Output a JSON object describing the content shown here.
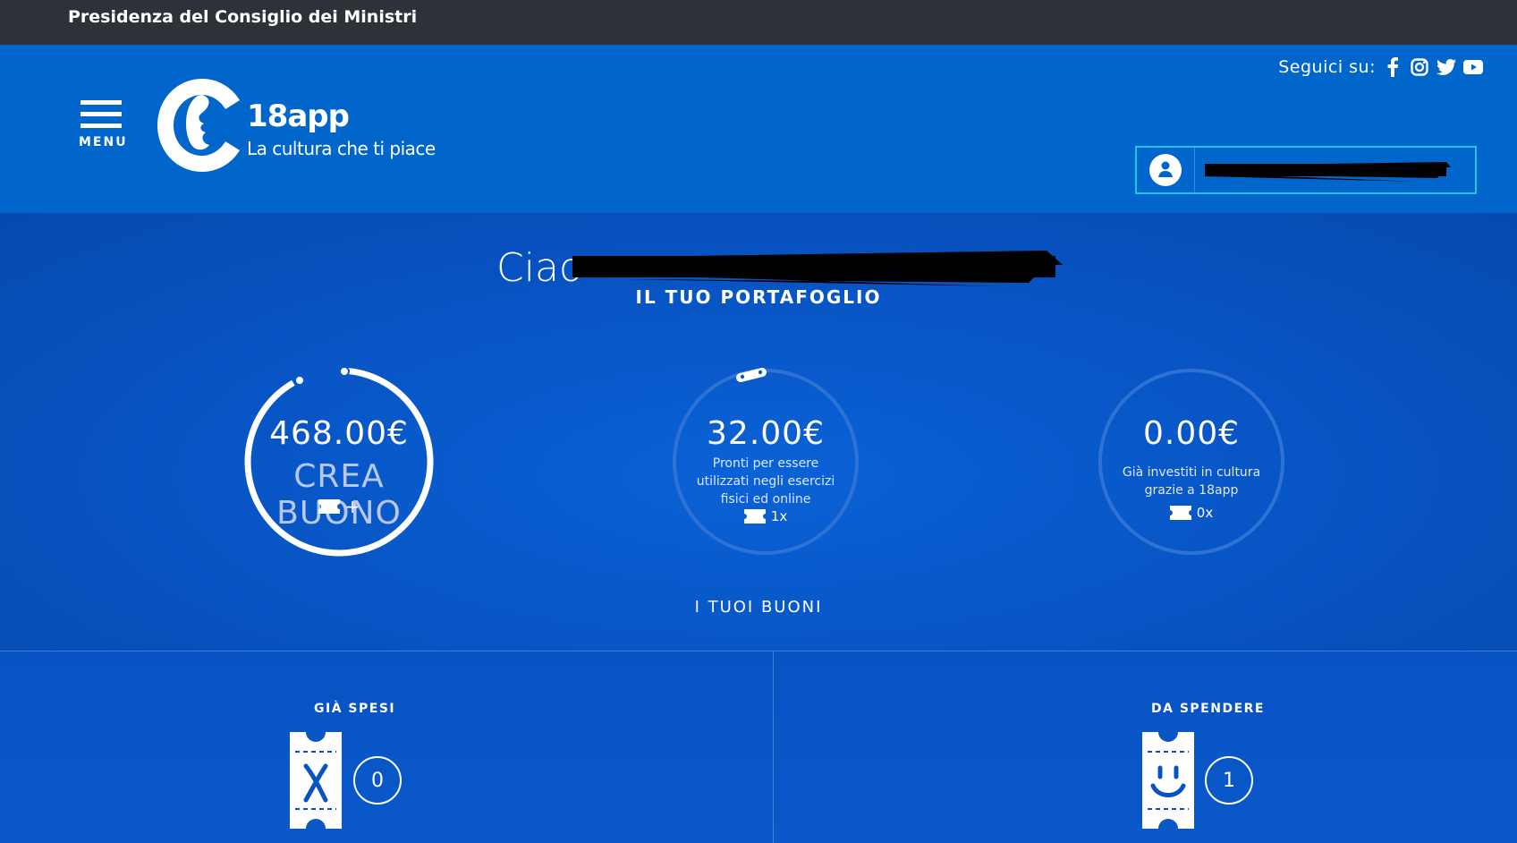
{
  "topbar": {
    "institution": "Presidenza del Consiglio dei Ministri"
  },
  "header": {
    "social_label": "Seguici su:",
    "social_icons": [
      "facebook-icon",
      "instagram-icon",
      "twitter-icon",
      "youtube-icon"
    ],
    "menu_label": "MENU",
    "logo": {
      "brand": "18app",
      "tagline": "La cultura che ti piace"
    },
    "user": {
      "icon": "user-icon"
    }
  },
  "main": {
    "greeting": "Ciao",
    "wallet_title": "IL TUO PORTAFOGLIO",
    "circles": [
      {
        "amount": "468.00€",
        "action": "CREA BUONO",
        "count": "+"
      },
      {
        "amount": "32.00€",
        "desc": "Pronti per essere utilizzati negli esercizi fisici ed online",
        "count": "1x"
      },
      {
        "amount": "0.00€",
        "desc": "Già investiti in cultura grazie a 18app",
        "count": "0x"
      }
    ],
    "vouchers_link": "I TUOI BUONI"
  },
  "lower": {
    "spent": {
      "title": "GIÀ SPESI",
      "count": "0",
      "icon": "ticket-cross-icon"
    },
    "to_spend": {
      "title": "DA SPENDERE",
      "count": "1",
      "icon": "ticket-smile-icon"
    }
  },
  "colors": {
    "topbar": "#2e3238",
    "header": "#0066cc",
    "accent_border": "#22c3e6",
    "main": "#0752c1"
  }
}
